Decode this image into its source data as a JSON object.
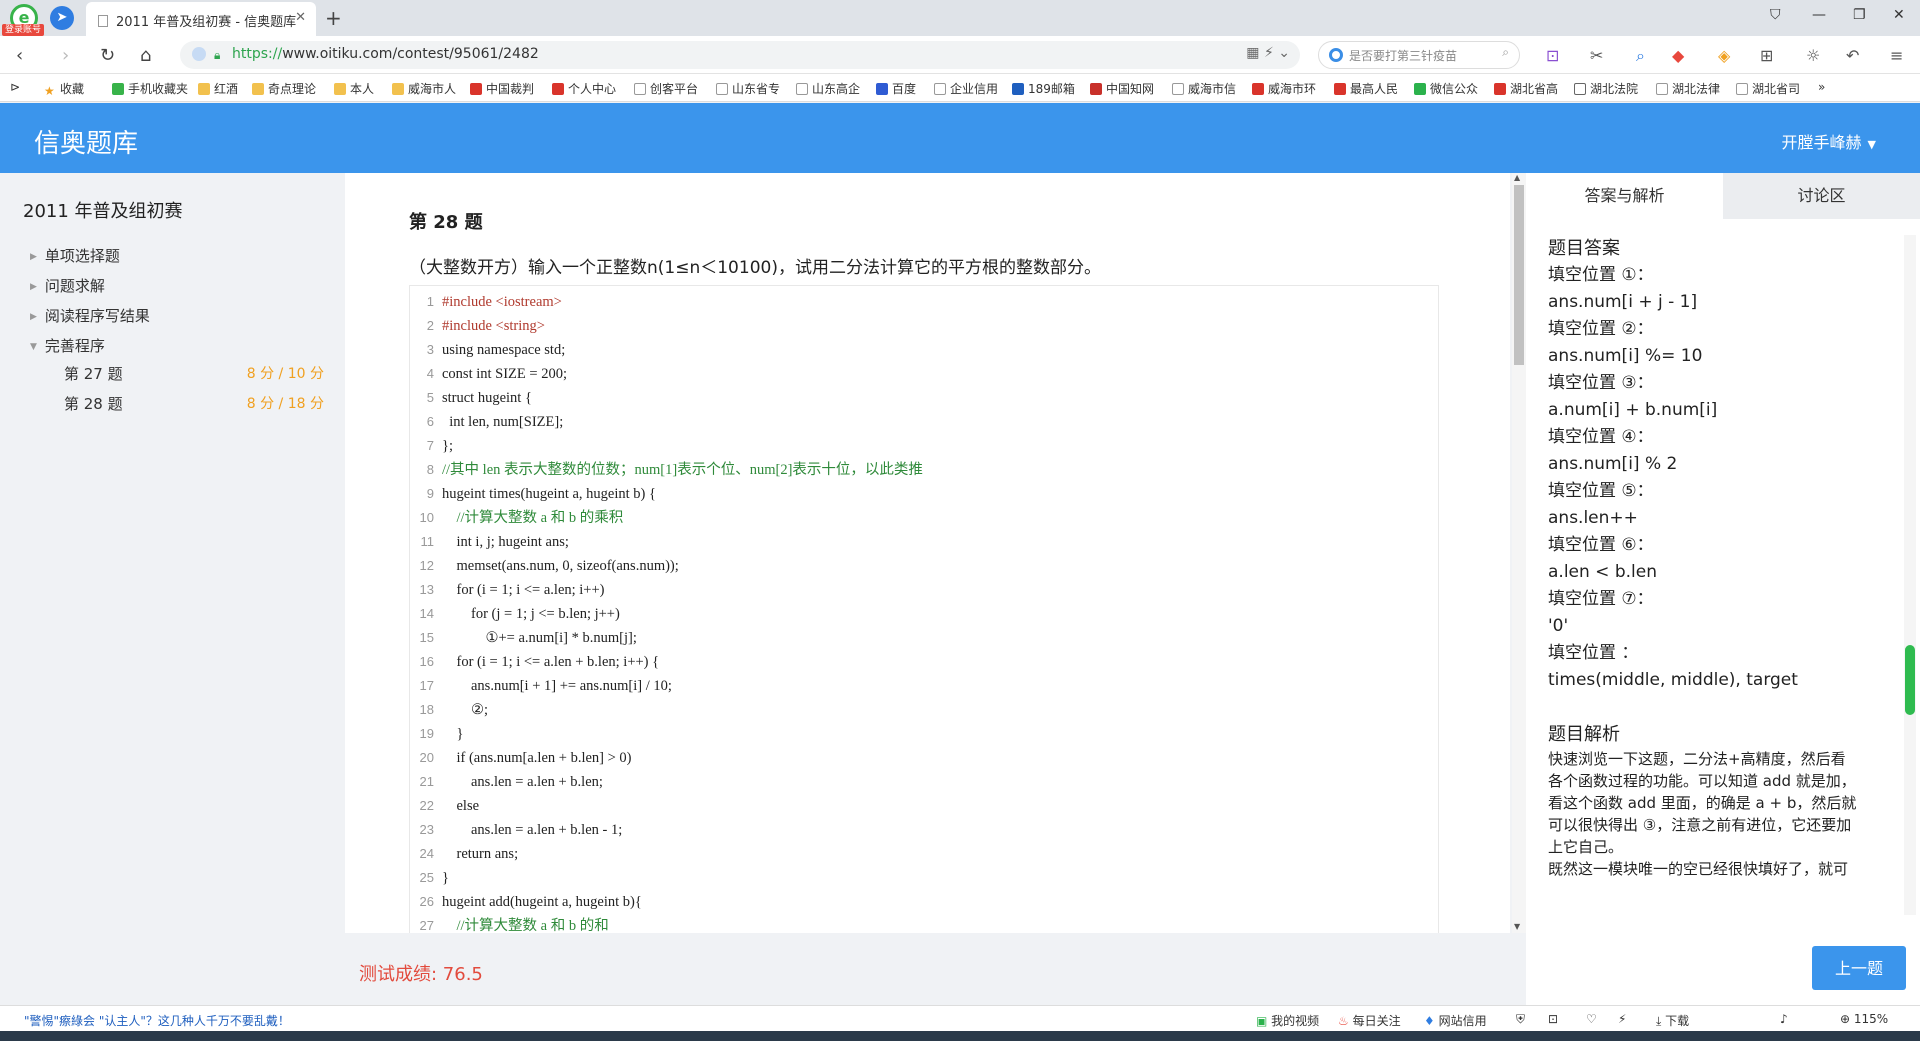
{
  "browser": {
    "login_badge": "登录账号",
    "tab_title": "2011 年普及组初赛 - 信奥题库",
    "url_scheme": "https://",
    "url_rest": "www.oitiku.com/contest/95061/2482",
    "search_placeholder": "是否要打第三针疫苗",
    "bookmarks": [
      "收藏",
      "手机收藏夹",
      "红酒",
      "奇点理论",
      "本人",
      "威海市人",
      "中国裁判",
      "个人中心",
      "创客平台",
      "山东省专",
      "山东高企",
      "百度",
      "企业信用",
      "189邮箱",
      "中国知网",
      "威海市信",
      "威海市环",
      "最高人民",
      "微信公众",
      "湖北省高",
      "湖北法院",
      "湖北法律",
      "湖北省司"
    ],
    "more": "»"
  },
  "site": {
    "title": "信奥题库",
    "user": "开膛手峰赫"
  },
  "sidebar": {
    "contest_title": "2011 年普及组初赛",
    "sections": [
      "单项选择题",
      "问题求解",
      "阅读程序写结果",
      "完善程序"
    ],
    "problems": [
      {
        "label": "第 27 题",
        "score": "8 分 / 10 分"
      },
      {
        "label": "第 28 题",
        "score": "8 分 / 18 分"
      }
    ]
  },
  "question": {
    "title": "第 28 题",
    "text": "（大整数开方）输入一个正整数n(1≤n＜10100)，试用二分法计算它的平方根的整数部分。"
  },
  "code_lines": [
    "#include <iostream>",
    "#include <string>",
    "using namespace std;",
    "const int SIZE = 200;",
    "struct hugeint {",
    "  int len, num[SIZE];",
    "};",
    "//其中 len 表示大整数的位数；num[1]表示个位、num[2]表示十位，以此类推",
    "hugeint times(hugeint a, hugeint b) {",
    "    //计算大整数 a 和 b 的乘积",
    "    int i, j; hugeint ans;",
    "    memset(ans.num, 0, sizeof(ans.num));",
    "    for (i = 1; i <= a.len; i++)",
    "        for (j = 1; j <= b.len; j++)",
    "            ①+= a.num[i] * b.num[j];",
    "    for (i = 1; i <= a.len + b.len; i++) {",
    "        ans.num[i + 1] += ans.num[i] / 10;",
    "        ②;",
    "    }",
    "    if (ans.num[a.len + b.len] > 0)",
    "        ans.len = a.len + b.len;",
    "    else",
    "        ans.len = a.len + b.len - 1;",
    "    return ans;",
    "}",
    "hugeint add(hugeint a, hugeint b){",
    "    //计算大整数 a 和 b 的和"
  ],
  "score": "测试成绩: 76.5",
  "right_panel": {
    "tab_answer": "答案与解析",
    "tab_discuss": "讨论区",
    "answer_heading": "题目答案",
    "answers": [
      {
        "label": "填空位置 ①：",
        "value": "ans.num[i + j - 1]"
      },
      {
        "label": "填空位置 ②：",
        "value": "ans.num[i] %= 10"
      },
      {
        "label": "填空位置 ③：",
        "value": "a.num[i] + b.num[i]"
      },
      {
        "label": "填空位置 ④：",
        "value": "ans.num[i] % 2"
      },
      {
        "label": "填空位置 ⑤：",
        "value": "ans.len++"
      },
      {
        "label": "填空位置 ⑥：",
        "value": "a.len < b.len"
      },
      {
        "label": "填空位置 ⑦：",
        "value": "'0'"
      },
      {
        "label": "填空位置 ：",
        "value": "times(middle, middle), target"
      }
    ],
    "analysis_heading": "题目解析",
    "analysis_lines": [
      "快速浏览一下这题，二分法+高精度，然后看",
      "各个函数过程的功能。可以知道 add 就是加，",
      "看这个函数 add 里面，的确是 a + b，然后就",
      "可以很快得出 ③，注意之前有进位，它还要加",
      "上它自己。",
      "既然这一模块唯一的空已经很快填好了，就可"
    ],
    "prev_button": "上一题"
  },
  "status": {
    "news": "\"警惕\"瘵綠会 \"认主人\"？这几种人千万不要乱戴！",
    "items": [
      "我的视频",
      "每日关注",
      "网站信用",
      "下载",
      "115%"
    ]
  }
}
